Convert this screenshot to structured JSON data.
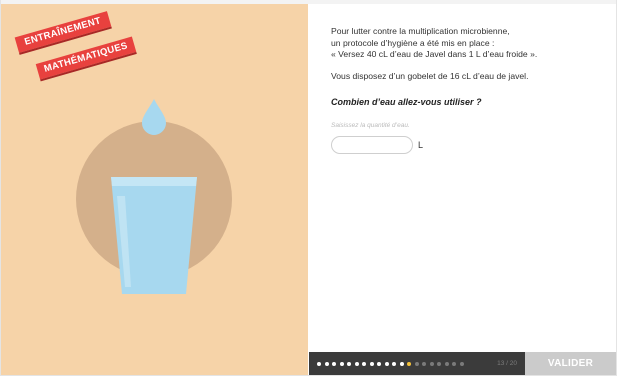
{
  "badge": {
    "line1": "ENTRAÎNEMENT",
    "line2": "MATHÉMATIQUES"
  },
  "exercise": {
    "instructions": [
      "Pour lutter contre la multiplication microbienne,",
      "un protocole d’hygiène a été mis en place :",
      "« Versez 40 cL d’eau de Javel dans 1 L d’eau froide »."
    ],
    "info": "Vous disposez d’un gobelet de 16 cL d’eau de javel.",
    "question": "Combien d’eau allez-vous utiliser ?",
    "answer_hint": "Saisissez la quantité d’eau.",
    "answer_value": "",
    "unit": "L"
  },
  "progress": {
    "counter": "13 / 20",
    "current": 13,
    "total": 20
  },
  "actions": {
    "validate_label": "VALIDER"
  },
  "colors": {
    "left_background": "#f6d3a8",
    "circle": "#d4b08b",
    "ribbon": "#e8413e",
    "glass": "#a7d8ef",
    "bottom_bar": "#3b3b3b",
    "current_dot": "#f5c23a",
    "validate_button": "#cbcbcb"
  },
  "icons": {
    "drop": "water-drop-icon",
    "glass": "glass-icon"
  }
}
